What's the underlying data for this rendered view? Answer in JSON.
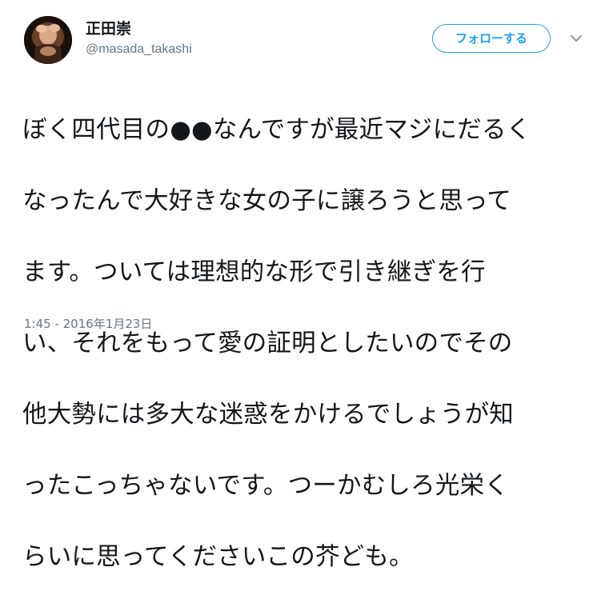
{
  "user": {
    "display_name": "正田崇",
    "handle": "@masada_takashi"
  },
  "header": {
    "follow_label": "フォローする",
    "more_icon": "chevron-down-icon"
  },
  "tweet": {
    "text_lines": [
      "ぼく四代目の●●なんですが最近マジにだるく",
      "なったんで大好きな女の子に譲ろうと思って",
      "ます。ついては理想的な形で引き継ぎを行",
      "い、それをもって愛の証明としたいのでその",
      "他大勢には多大な迷惑をかけるでしょうが知",
      "ったこっちゃないです。つーかむしろ光栄く",
      "らいに思ってくださいこの芥ども。"
    ],
    "timestamp": "1:45 - 2016年1月23日"
  },
  "colors": {
    "accent": "#1da1f2",
    "text": "#14171a",
    "secondary": "#657786"
  }
}
